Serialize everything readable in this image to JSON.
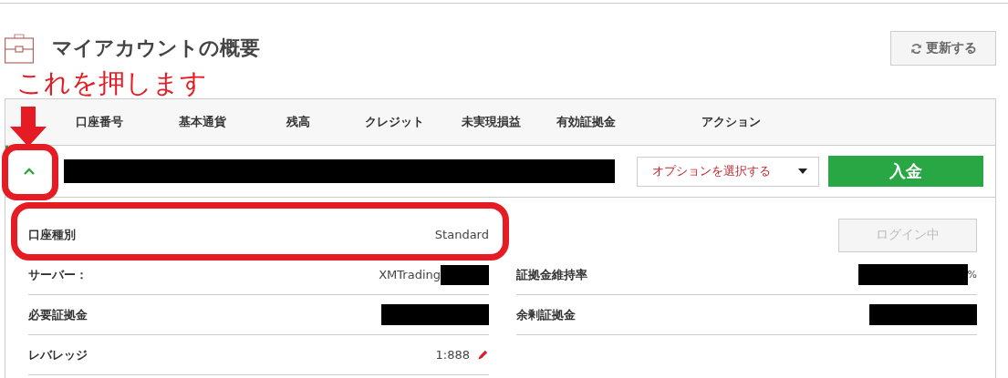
{
  "page": {
    "title": "マイアカウントの概要",
    "refresh_button": "更新する"
  },
  "annotation": {
    "text": "これを押します"
  },
  "table": {
    "columns": [
      "口座番号",
      "基本通貨",
      "残高",
      "クレジット",
      "未実現損益",
      "有効証拠金",
      "アクション"
    ],
    "account": {
      "expanded": true,
      "options_select": "オプションを選択する",
      "deposit_button": "入金"
    },
    "details_left": [
      {
        "label": "口座種別",
        "value": "Standard",
        "redacted": false,
        "editable": false
      },
      {
        "label": "サーバー：",
        "value": "XMTrading",
        "redacted": true,
        "editable": false
      },
      {
        "label": "必要証拠金",
        "redacted": true,
        "editable": false
      },
      {
        "label": "レバレッジ",
        "value": "1:888",
        "redacted": false,
        "editable": true
      }
    ],
    "login_button": {
      "label": "ログイン中",
      "disabled": true
    },
    "details_right": [
      {
        "label": "証拠金維持率",
        "suffix": "%",
        "redacted": true
      },
      {
        "label": "余剰証拠金",
        "redacted": true
      }
    ]
  }
}
